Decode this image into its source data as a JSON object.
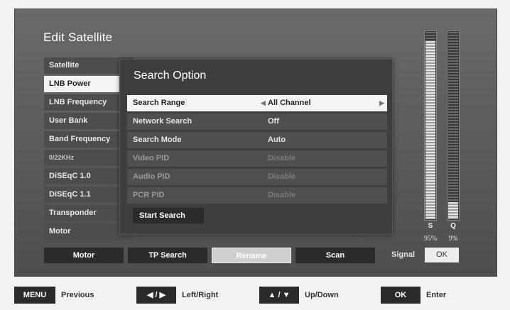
{
  "screen": {
    "title": "Edit Satellite"
  },
  "menu": {
    "items": [
      {
        "label": "Satellite"
      },
      {
        "label": "LNB Power"
      },
      {
        "label": "LNB Frequency"
      },
      {
        "label": "User Bank"
      },
      {
        "label": "Band Frequency"
      },
      {
        "label": "0/22KHz"
      },
      {
        "label": "DiSEqC 1.0"
      },
      {
        "label": "DiSEqC 1.1"
      },
      {
        "label": "Transponder"
      },
      {
        "label": "Motor"
      }
    ],
    "active_index": 1
  },
  "popup": {
    "title": "Search Option",
    "options": [
      {
        "label": "Search Range",
        "value": "All Channel"
      },
      {
        "label": "Network Search",
        "value": "Off"
      },
      {
        "label": "Search Mode",
        "value": "Auto"
      },
      {
        "label": "Video PID",
        "value": "Disable"
      },
      {
        "label": "Audio PID",
        "value": "Disable"
      },
      {
        "label": "PCR PID",
        "value": "Disable"
      }
    ],
    "start_label": "Start Search"
  },
  "actions": {
    "motor": "Motor",
    "tp_search": "TP Search",
    "rename": "Rename",
    "scan": "Scan"
  },
  "signal": {
    "s_label": "S",
    "q_label": "Q",
    "s_value": "95%",
    "q_value": "9%",
    "s_level": 0.95,
    "q_level": 0.09,
    "signal_label": "Signal",
    "status": "OK"
  },
  "legend": {
    "menu_key": "MENU",
    "menu_action": "Previous",
    "lr_key": "◀ / ▶",
    "lr_action": "Left/Right",
    "ud_key": "▲ / ▼",
    "ud_action": "Up/Down",
    "ok_key": "OK",
    "ok_action": "Enter"
  }
}
